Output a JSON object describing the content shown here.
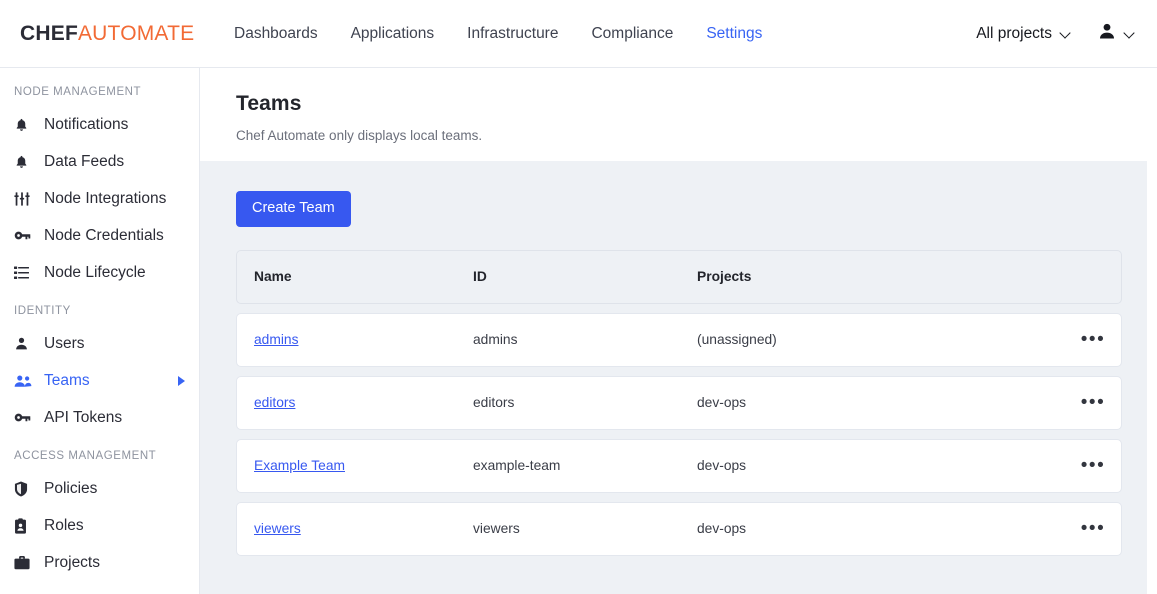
{
  "brand": {
    "part1": "CHEF",
    "part2": "AUTOMATE",
    "color1": "#2b2c36",
    "color2": "#f26a35"
  },
  "topnav": {
    "links": [
      {
        "label": "Dashboards",
        "active": false
      },
      {
        "label": "Applications",
        "active": false
      },
      {
        "label": "Infrastructure",
        "active": false
      },
      {
        "label": "Compliance",
        "active": false
      },
      {
        "label": "Settings",
        "active": true
      }
    ],
    "project_filter": "All projects",
    "accent": "#3864f4"
  },
  "sidebar": {
    "sections": [
      {
        "heading": "NODE MANAGEMENT",
        "items": [
          {
            "label": "Notifications",
            "icon": "bell-icon",
            "active": false
          },
          {
            "label": "Data Feeds",
            "icon": "bell-icon",
            "active": false
          },
          {
            "label": "Node Integrations",
            "icon": "sliders-icon",
            "active": false
          },
          {
            "label": "Node Credentials",
            "icon": "key-icon",
            "active": false
          },
          {
            "label": "Node Lifecycle",
            "icon": "list-icon",
            "active": false
          }
        ]
      },
      {
        "heading": "IDENTITY",
        "items": [
          {
            "label": "Users",
            "icon": "user-icon",
            "active": false
          },
          {
            "label": "Teams",
            "icon": "users-icon",
            "active": true,
            "caret": true
          },
          {
            "label": "API Tokens",
            "icon": "key-icon",
            "active": false
          }
        ]
      },
      {
        "heading": "ACCESS MANAGEMENT",
        "items": [
          {
            "label": "Policies",
            "icon": "shield-icon",
            "active": false
          },
          {
            "label": "Roles",
            "icon": "badge-icon",
            "active": false
          },
          {
            "label": "Projects",
            "icon": "briefcase-icon",
            "active": false
          }
        ]
      }
    ]
  },
  "page": {
    "title": "Teams",
    "subtitle": "Chef Automate only displays local teams.",
    "create_button": "Create Team"
  },
  "table": {
    "columns": [
      "Name",
      "ID",
      "Projects"
    ],
    "rows": [
      {
        "name": "admins",
        "id": "admins",
        "projects": "(unassigned)",
        "menu": "•••"
      },
      {
        "name": "editors",
        "id": "editors",
        "projects": "dev-ops",
        "menu": "•••"
      },
      {
        "name": "Example Team",
        "id": "example-team",
        "projects": "dev-ops",
        "menu": "•••"
      },
      {
        "name": "viewers",
        "id": "viewers",
        "projects": "dev-ops",
        "menu": "•••"
      }
    ]
  }
}
